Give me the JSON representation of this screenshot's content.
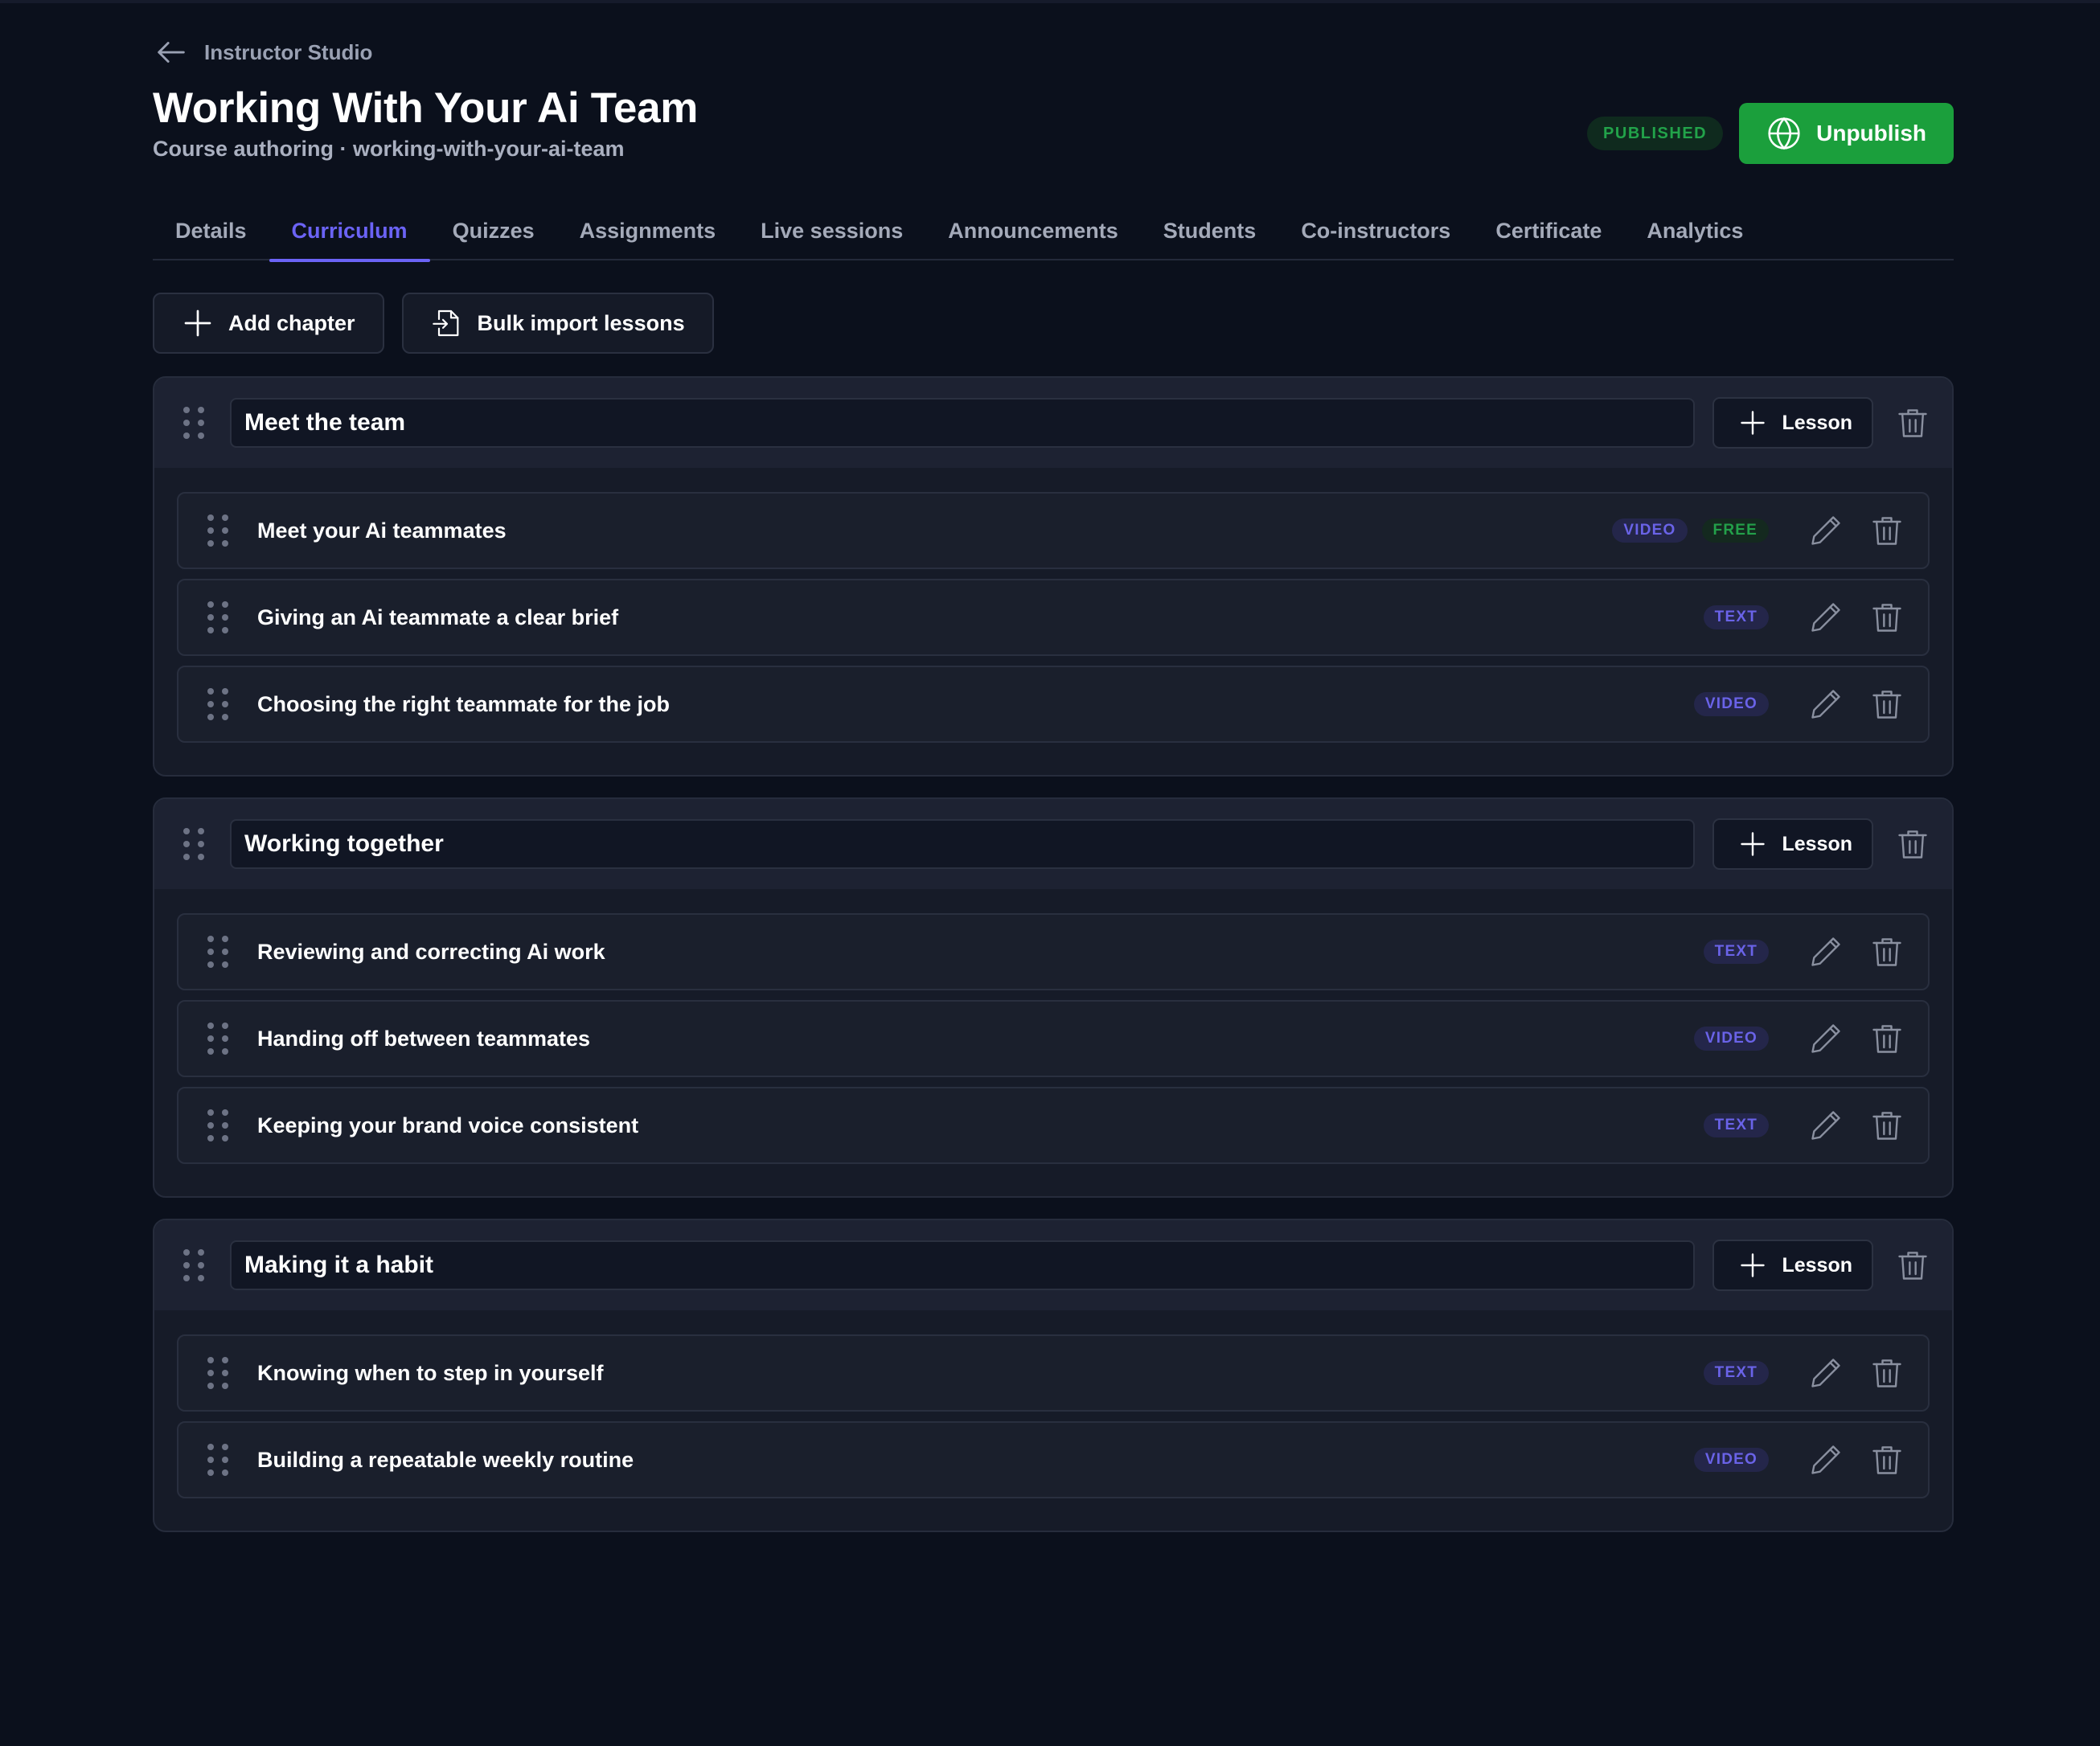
{
  "back": {
    "label": "Instructor Studio",
    "icon": "arrow-left-icon"
  },
  "header": {
    "title": "Working With Your Ai Team",
    "subtitle": "Course authoring · working-with-your-ai-team",
    "status_badge": "PUBLISHED",
    "unpublish_label": "Unpublish",
    "unpublish_icon": "globe-icon"
  },
  "tabs": [
    {
      "label": "Details"
    },
    {
      "label": "Curriculum",
      "active": true
    },
    {
      "label": "Quizzes"
    },
    {
      "label": "Assignments"
    },
    {
      "label": "Live sessions"
    },
    {
      "label": "Announcements"
    },
    {
      "label": "Students"
    },
    {
      "label": "Co-instructors"
    },
    {
      "label": "Certificate"
    },
    {
      "label": "Analytics"
    }
  ],
  "toolbar": {
    "add_chapter_label": "Add chapter",
    "bulk_import_label": "Bulk import lessons"
  },
  "lesson_button_label": "Lesson",
  "chapters": [
    {
      "title": "Meet the team",
      "lessons": [
        {
          "title": "Meet your Ai teammates",
          "type": "VIDEO",
          "free": "FREE"
        },
        {
          "title": "Giving an Ai teammate a clear brief",
          "type": "TEXT"
        },
        {
          "title": "Choosing the right teammate for the job",
          "type": "VIDEO"
        }
      ]
    },
    {
      "title": "Working together",
      "lessons": [
        {
          "title": "Reviewing and correcting Ai work",
          "type": "TEXT"
        },
        {
          "title": "Handing off between teammates",
          "type": "VIDEO"
        },
        {
          "title": "Keeping your brand voice consistent",
          "type": "TEXT"
        }
      ]
    },
    {
      "title": "Making it a habit",
      "lessons": [
        {
          "title": "Knowing when to step in yourself",
          "type": "TEXT"
        },
        {
          "title": "Building a repeatable weekly routine",
          "type": "VIDEO"
        }
      ]
    }
  ],
  "colors": {
    "background": "#0b101c",
    "accent": "#6b63f5",
    "published_green": "#1b9f3c",
    "type_tag": "#6a63e8",
    "free_tag": "#23a04a"
  }
}
